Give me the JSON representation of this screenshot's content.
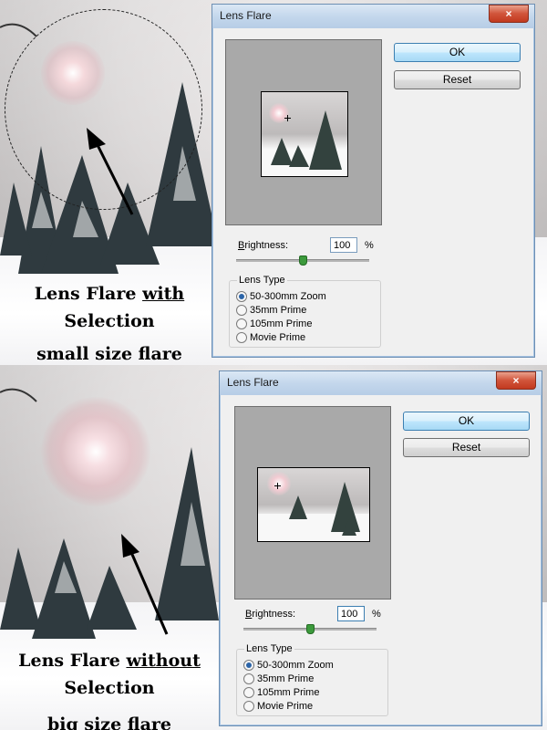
{
  "top": {
    "caption": {
      "pre": "Lens Flare ",
      "u": "with",
      "post": " Selection",
      "line2": "small size flare"
    },
    "dialog": {
      "title": "Lens Flare",
      "ok_label": "OK",
      "reset_label": "Reset",
      "brightness_label": "Brightness:",
      "brightness_value": "100",
      "percent": "%",
      "brightness_level": 0.5,
      "lens_type_label": "Lens Type",
      "lens_options": [
        "50-300mm Zoom",
        "35mm Prime",
        "105mm Prime",
        "Movie Prime"
      ],
      "selected_lens": 0,
      "close_icon": "×"
    }
  },
  "bottom": {
    "caption": {
      "pre": "Lens Flare ",
      "u": "without",
      "post": " Selection",
      "line2": "big size flare"
    },
    "dialog": {
      "title": "Lens Flare",
      "ok_label": "OK",
      "reset_label": "Reset",
      "brightness_label": "Brightness:",
      "brightness_value": "100",
      "percent": "%",
      "brightness_level": 0.5,
      "lens_type_label": "Lens Type",
      "lens_options": [
        "50-300mm Zoom",
        "35mm Prime",
        "105mm Prime",
        "Movie Prime"
      ],
      "selected_lens": 0,
      "close_icon": "×"
    }
  },
  "colors": {
    "accent": "#3c7fb1",
    "close": "#c23a1f",
    "slider_knob": "#3c9a3c"
  }
}
